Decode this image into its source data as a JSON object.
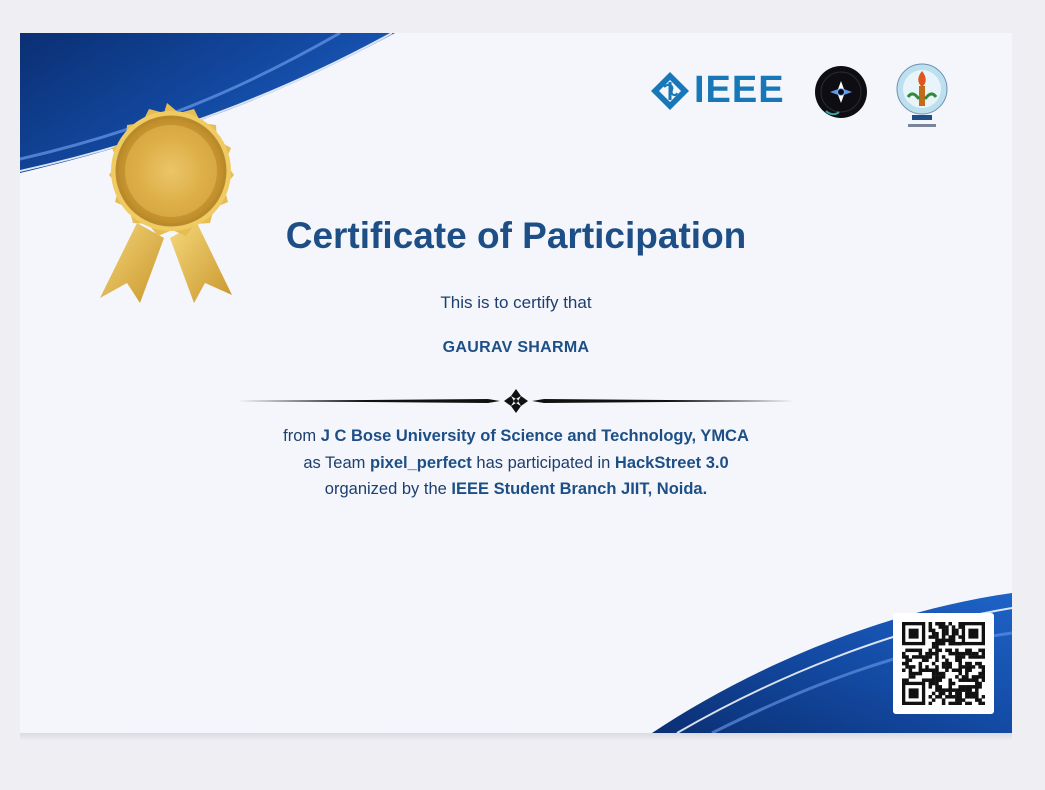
{
  "certificate": {
    "title": "Certificate of Participation",
    "certify_line": "This is to certify that",
    "recipient_name": "GAURAV SHARMA",
    "body": {
      "from_word": "from",
      "university": "J C Bose University of Science and Technology, YMCA",
      "as_team": "as Team",
      "team_name": "pixel_perfect",
      "participated": "has participated in",
      "event": "HackStreet 3.0",
      "organized_by": "organized by the",
      "organizer": "IEEE Student Branch JIIT, Noida."
    }
  },
  "logos": {
    "ieee_text": "IEEE",
    "ieee_icon": "ieee-diamond-icon",
    "society_logo": "dark-circle-logo",
    "jiit_logo": "jiit-emblem"
  },
  "decorations": {
    "medal": "gold-rosette-medal-icon",
    "divider_ornament": "cross-ornament-icon",
    "qr": "qr-code"
  },
  "colors": {
    "title": "#1d4f86",
    "body_text": "#1d3f6e",
    "page_bg": "#f4f6fc",
    "corner_blue": "#0d3f8f",
    "ieee_blue": "#1877b6",
    "gold": "#d4a93a"
  }
}
